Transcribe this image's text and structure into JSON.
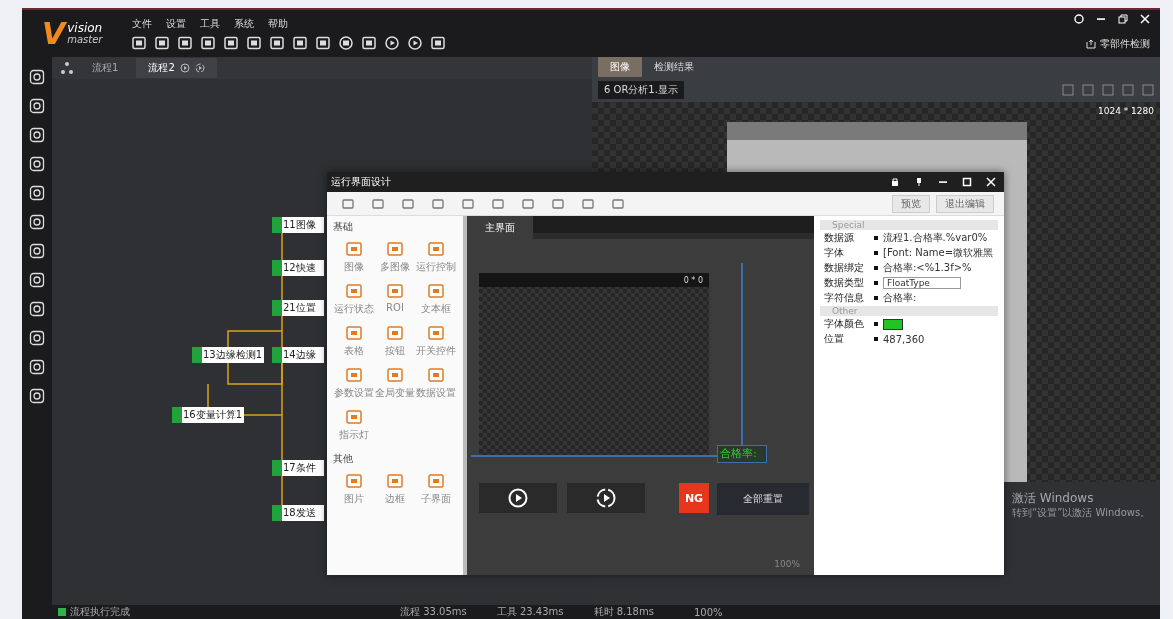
{
  "logo": {
    "mark": "V",
    "top": "vision",
    "bottom": "master"
  },
  "menu": [
    "文件",
    "设置",
    "工具",
    "系统",
    "帮助"
  ],
  "solution_button": "零部件检测",
  "flow_tabs": [
    {
      "label": "流程1",
      "selected": false
    },
    {
      "label": "流程2",
      "selected": true
    }
  ],
  "flow_nodes": [
    {
      "label": "11图像"
    },
    {
      "label": "12快速"
    },
    {
      "label": "21位置"
    },
    {
      "label": "13边缘检测1"
    },
    {
      "label": "14边缘"
    },
    {
      "label": "16变量计算1"
    },
    {
      "label": "17条件"
    },
    {
      "label": "18发送"
    }
  ],
  "right_tabs": [
    {
      "label": "图像",
      "selected": true
    },
    {
      "label": "检测结果",
      "selected": false
    }
  ],
  "image_source": "6 OR分析1.显示",
  "image_size": "1024 * 1280",
  "designer": {
    "title": "运行界面设计",
    "buttons": [
      "预览",
      "退出编辑"
    ],
    "palette": [
      {
        "title": "基础",
        "items": [
          "图像",
          "多图像",
          "运行控制",
          "运行状态",
          "ROI",
          "文本框",
          "表格",
          "按钮",
          "开关控件",
          "参数设置",
          "全局变量",
          "数据设置",
          "指示灯"
        ]
      },
      {
        "title": "其他",
        "items": [
          "图片",
          "边框",
          "子界面"
        ]
      }
    ],
    "page_tab": "主界面",
    "image_control_size": "0 * 0",
    "label_text": "合格率:",
    "ng_badge": "NG",
    "reset_button": "全部重置",
    "zoom": "100%",
    "properties": [
      {
        "group": "Special",
        "rows": [
          {
            "name": "数据源",
            "value": "流程1.合格率.%var0%",
            "kind": "text"
          },
          {
            "name": "字体",
            "value": "[Font: Name=微软雅黑",
            "kind": "text"
          },
          {
            "name": "数据绑定",
            "value": "合格率:<%1.3f>%",
            "kind": "text"
          },
          {
            "name": "数据类型",
            "value": "FloatType",
            "kind": "select"
          },
          {
            "name": "字符信息",
            "value": "合格率:",
            "kind": "text"
          }
        ]
      },
      {
        "group": "Other",
        "rows": [
          {
            "name": "字体颜色",
            "kind": "color",
            "color": "#22c322"
          },
          {
            "name": "位置",
            "value": "487,360",
            "kind": "text"
          }
        ]
      }
    ]
  },
  "status": {
    "message": "流程执行完成",
    "flow_time": "流程 33.05ms",
    "tool_time": "工具 23.43ms",
    "total_time": "耗时 8.18ms",
    "zoom": "100%"
  },
  "windows_notice": [
    "激活 Windows",
    "转到“设置”以激活 Windows。"
  ]
}
